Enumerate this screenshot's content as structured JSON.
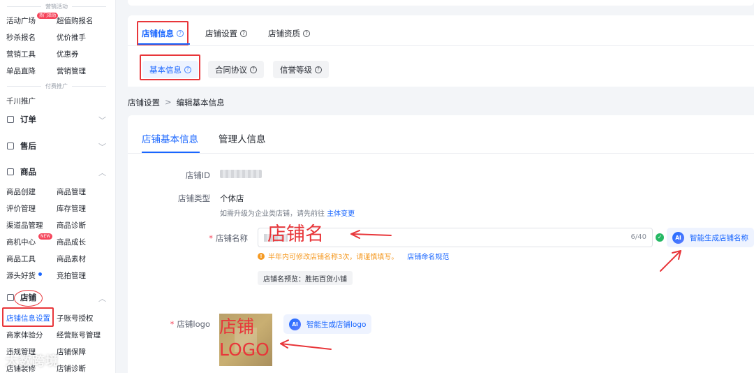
{
  "sidebar": {
    "marketing_header": "营销活动",
    "marketing_items": [
      "活动广场",
      "超值购报名",
      "秒杀报名",
      "优价推手",
      "营销工具",
      "优惠券",
      "单品直降",
      "营销管理"
    ],
    "hot_badge": "热门活动",
    "paid_header": "付费推广",
    "paid_items": [
      "千川推广"
    ],
    "groups": {
      "order": "订单",
      "aftersale": "售后",
      "product": "商品",
      "shop": "店铺"
    },
    "product_items": [
      "商品创建",
      "商品管理",
      "评价管理",
      "库存管理",
      "渠道品管理",
      "商品诊断",
      "商机中心",
      "商品成长",
      "商品工具",
      "商品素材",
      "源头好货",
      "竞拍管理"
    ],
    "new_badge": "NEW",
    "shop_items": [
      "店铺信息设置",
      "子账号授权",
      "商家体验分",
      "经营账号管理",
      "违规管理",
      "店铺保障",
      "店铺装修",
      "店铺诊断"
    ],
    "watermark": "大数跨境"
  },
  "tabs": [
    "店铺信息",
    "店铺设置",
    "店铺资质"
  ],
  "subtabs": [
    "基本信息",
    "合同协议",
    "信誉等级"
  ],
  "breadcrumb": [
    "店铺设置",
    "编辑基本信息"
  ],
  "form_tabs": [
    "店铺基本信息",
    "管理人信息"
  ],
  "form": {
    "shop_id_label": "店铺ID",
    "shop_type_label": "店铺类型",
    "shop_type_value": "个体店",
    "upgrade_hint": "如需升级为企业类店铺，请先前往",
    "upgrade_link": "主体变更",
    "shop_name_label": "店铺名称",
    "name_count": "6/40",
    "ai_name_button": "智能生成店铺名称",
    "name_warning": "半年内可修改店铺名称3次，请谨慎填写。",
    "name_rule_link": "店铺命名规范",
    "name_preview": "店铺名预览：胜拓百货小铺",
    "logo_label": "店铺logo",
    "ai_logo_button": "智能生成店铺logo",
    "ai_badge": "AI"
  },
  "annotations": {
    "shop_name": "店铺名",
    "shop_logo_line1": "店铺",
    "shop_logo_line2": "LOGO"
  },
  "colors": {
    "accent": "#1966ff",
    "annotation": "#e8363a",
    "warning": "#f59a23",
    "success": "#25b864"
  }
}
